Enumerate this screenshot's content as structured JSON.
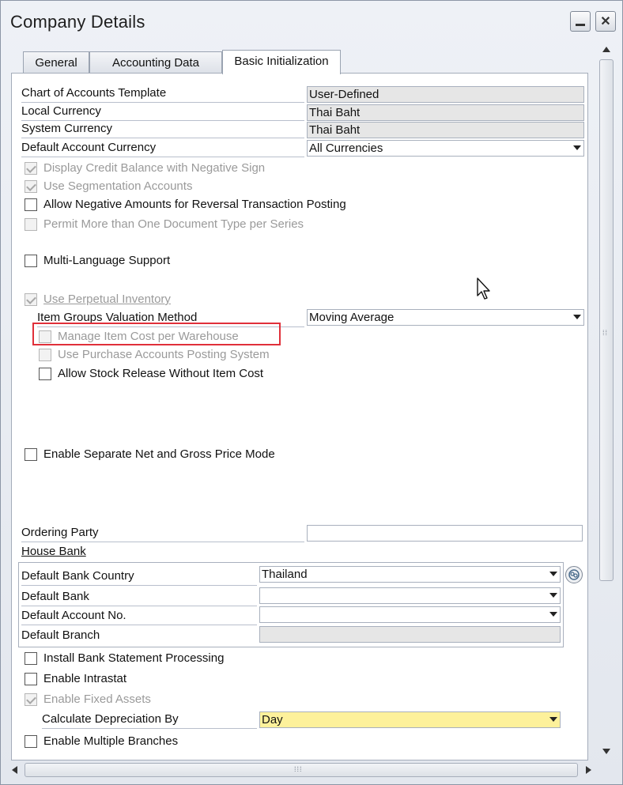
{
  "window": {
    "title": "Company Details"
  },
  "tabs": [
    {
      "label": "General"
    },
    {
      "label": "Accounting Data"
    },
    {
      "label": "Basic Initialization"
    }
  ],
  "fields": {
    "chart_template": {
      "label": "Chart of Accounts Template",
      "value": "User-Defined"
    },
    "local_currency": {
      "label": "Local Currency",
      "value": "Thai Baht"
    },
    "system_currency": {
      "label": "System Currency",
      "value": "Thai Baht"
    },
    "default_account_currency": {
      "label": "Default Account Currency",
      "value": "All Currencies"
    },
    "valuation_method": {
      "label": "Item Groups Valuation Method",
      "value": "Moving Average"
    },
    "ordering_party": {
      "label": "Ordering Party",
      "value": ""
    },
    "house_bank": {
      "label": "House Bank"
    },
    "default_bank_country": {
      "label": "Default Bank Country",
      "value": "Thailand"
    },
    "default_bank": {
      "label": "Default Bank",
      "value": ""
    },
    "default_account_no": {
      "label": "Default Account No.",
      "value": ""
    },
    "default_branch": {
      "label": "Default Branch",
      "value": ""
    },
    "depreciation_by": {
      "label": "Calculate Depreciation By",
      "value": "Day"
    }
  },
  "checkboxes": {
    "credit_balance_negative": "Display Credit Balance with Negative Sign",
    "segmentation": "Use Segmentation Accounts",
    "negative_reversal": "Allow Negative Amounts for Reversal Transaction Posting",
    "multi_doc_type": "Permit More than One Document Type per Series",
    "multi_language": "Multi-Language Support",
    "perpetual_inventory": "Use Perpetual Inventory",
    "cost_per_warehouse": "Manage Item Cost per Warehouse",
    "purchase_accounts": "Use Purchase Accounts Posting System",
    "stock_release": "Allow Stock Release Without Item Cost",
    "net_gross_price": "Enable Separate Net and Gross Price Mode",
    "bank_statement": "Install Bank Statement Processing",
    "intrastat": "Enable Intrastat",
    "fixed_assets": "Enable Fixed Assets",
    "multiple_branches": "Enable Multiple Branches"
  },
  "colors": {
    "highlight": "#e0303a",
    "mandatory_field": "#fdf19b"
  }
}
